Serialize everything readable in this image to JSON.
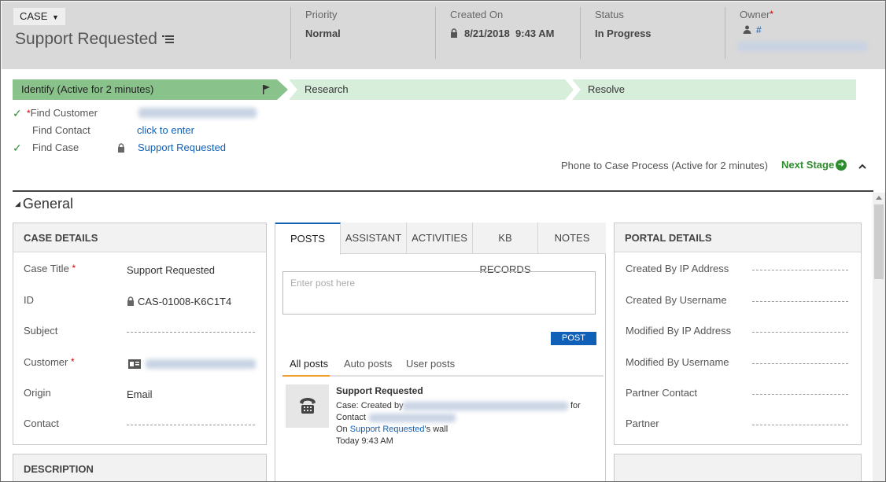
{
  "header": {
    "entity": "CASE",
    "title": "Support Requested",
    "fields": [
      {
        "label": "Priority",
        "value": "Normal"
      },
      {
        "label": "Created On",
        "value": "8/21/2018  9:43 AM"
      },
      {
        "label": "Status",
        "value": "In Progress"
      },
      {
        "label": "Owner",
        "value": "#"
      }
    ]
  },
  "process": {
    "stages": [
      "Identify (Active for 2 minutes)",
      "Research",
      "Resolve"
    ],
    "steps": [
      {
        "label": "Find Customer",
        "value": ""
      },
      {
        "label": "Find Contact",
        "value": "click to enter"
      },
      {
        "label": "Find Case",
        "value": "Support Requested"
      }
    ],
    "name": "Phone to Case Process (Active for 2 minutes)",
    "next_stage": "Next Stage"
  },
  "section": {
    "title": "General"
  },
  "case_details": {
    "title": "CASE DETAILS",
    "rows": [
      {
        "label": "Case Title",
        "value": "Support Requested"
      },
      {
        "label": "ID",
        "value": "CAS-01008-K6C1T4"
      },
      {
        "label": "Subject",
        "value": ""
      },
      {
        "label": "Customer",
        "value": ""
      },
      {
        "label": "Origin",
        "value": "Email"
      },
      {
        "label": "Contact",
        "value": ""
      }
    ]
  },
  "description": {
    "title": "DESCRIPTION"
  },
  "posts": {
    "tabs": [
      "POSTS",
      "ASSISTANT",
      "ACTIVITIES",
      "KB RECORDS",
      "NOTES"
    ],
    "placeholder": "Enter post here",
    "post_button": "POST",
    "filters": [
      "All posts",
      "Auto posts",
      "User posts"
    ],
    "item": {
      "title": "Support Requested",
      "line1_prefix": "Case: Created by",
      "line1_suffix": "for",
      "line2": "Contact",
      "wall_prefix": "On",
      "wall_link": "Support Requested",
      "wall_suffix": "'s wall",
      "time": "Today 9:43 AM"
    }
  },
  "portal_details": {
    "title": "PORTAL DETAILS",
    "rows": [
      "Created By IP Address",
      "Created By Username",
      "Modified By IP Address",
      "Modified By Username",
      "Partner Contact",
      "Partner"
    ]
  },
  "colors": {
    "accent": "#1160b7",
    "active_stage": "#8ac28c",
    "stage": "#d7eedb",
    "next": "#2e8b2e"
  }
}
